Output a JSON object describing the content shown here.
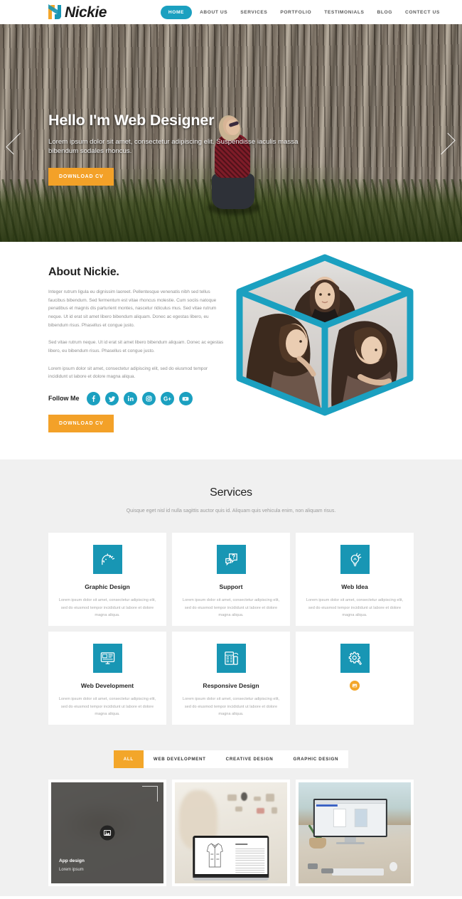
{
  "brand": {
    "name": "Nickie",
    "logo_icon": "n-monogram-logo",
    "accent_teal": "#1ba0c0",
    "accent_orange": "#f3a128",
    "icon_teal": "#1896b4"
  },
  "nav": {
    "items": [
      {
        "label": "HOME",
        "active": true
      },
      {
        "label": "ABOUT US",
        "active": false
      },
      {
        "label": "SERVICES",
        "active": false
      },
      {
        "label": "PORTFOLIO",
        "active": false
      },
      {
        "label": "TESTIMONIALS",
        "active": false
      },
      {
        "label": "BLOG",
        "active": false
      },
      {
        "label": "CONTECT US",
        "active": false
      }
    ]
  },
  "hero": {
    "title": "Hello I'm Web Designer",
    "subtitle": "Lorem ipsum dolor sit amet, consectetur adipiscing elit. Suspendisse iaculis massa bibendum sodales rhoncus.",
    "cta_label": "DOWNLOAD CV",
    "prev_icon": "chevron-left-icon",
    "next_icon": "chevron-right-icon"
  },
  "about": {
    "title": "About Nickie.",
    "paragraph1": "Integer rutrum ligula eu dignissim laoreet. Pellentesque venenatis nibh sed tellus faucibus bibendum. Sed fermentum est vitae rhoncus molestie. Cum sociis natoque penatibus et magnis dis parturient montes, nascetur ridiculus mus. Sed vitae rutrum neque. Ut id erat sit amet libero bibendum aliquam. Donec ac egestas libero, eu bibendum risus. Phasellus et congue justo.",
    "paragraph2": "Sed vitae rutrum neque. Ut id erat sit amet libero bibendum aliquam. Donec ac egestas libero, eu bibendum risus. Phasellus et congue justo.",
    "paragraph3": "Lorem ipsum dolor sit amet, consectetur adipiscing elit, sed do eiusmod tempor incididunt ut labore et dolore magna aliqua.",
    "follow_label": "Follow Me",
    "cta_label": "DOWNLOAD CV",
    "social": [
      {
        "name": "facebook-icon",
        "label": "f"
      },
      {
        "name": "twitter-icon",
        "label": "t"
      },
      {
        "name": "linkedin-icon",
        "label": "in"
      },
      {
        "name": "instagram-icon",
        "label": "ig"
      },
      {
        "name": "google-plus-icon",
        "label": "G+"
      },
      {
        "name": "youtube-icon",
        "label": "yt"
      }
    ],
    "cube_alt": "three-photo-cube"
  },
  "services": {
    "title": "Services",
    "subtitle": "Quisque eget nisl id nulla sagittis auctor quis id. Aliquam quis vehicula enim, non aliquam risus.",
    "cards": [
      {
        "icon": "head-idea-icon",
        "title": "Graphic Design",
        "desc": "Lorem ipsum dolor sit amet, consectetur adipiscing elit, sed do eiusmod tempor incididunt ut labore et dolore magna aliqua."
      },
      {
        "icon": "chat-support-icon",
        "title": "Support",
        "desc": "Lorem ipsum dolor sit amet, consectetur adipiscing elit, sed do eiusmod tempor incididunt ut labore et dolore magna aliqua."
      },
      {
        "icon": "lightbulb-idea-icon",
        "title": "Web Idea",
        "desc": "Lorem ipsum dolor sit amet, consectetur adipiscing elit, sed do eiusmod tempor incididunt ut labore et dolore magna aliqua."
      },
      {
        "icon": "monitor-code-icon",
        "title": "Web Development",
        "desc": "Lorem ipsum dolor sit amet, consectetur adipiscing elit, sed do eiusmod tempor incididunt ut labore et dolore magna aliqua."
      },
      {
        "icon": "responsive-layout-icon",
        "title": "Responsive Design",
        "desc": "Lorem ipsum dolor sit amet, consectetur adipiscing elit, sed do eiusmod tempor incididunt ut labore et dolore magna aliqua."
      },
      {
        "icon": "gear-tools-icon",
        "title": "",
        "desc": "",
        "badge": "broken-image-badge"
      }
    ]
  },
  "portfolio": {
    "filters": [
      {
        "label": "ALL",
        "active": true
      },
      {
        "label": "WEB DEVELOPMENT",
        "active": false
      },
      {
        "label": "CREATIVE DESIGN",
        "active": false
      },
      {
        "label": "GRAPHIC DESIGN",
        "active": false
      }
    ],
    "items": [
      {
        "title": "App design",
        "subtitle": "Lorem ipsum",
        "overlay": true,
        "zoom_icon": "image-icon",
        "alt": "app-design-thumbnail"
      },
      {
        "title": "",
        "subtitle": "",
        "overlay": false,
        "alt": "laptop-sketch-thumbnail"
      },
      {
        "title": "",
        "subtitle": "",
        "overlay": false,
        "alt": "imac-desk-thumbnail"
      }
    ]
  }
}
